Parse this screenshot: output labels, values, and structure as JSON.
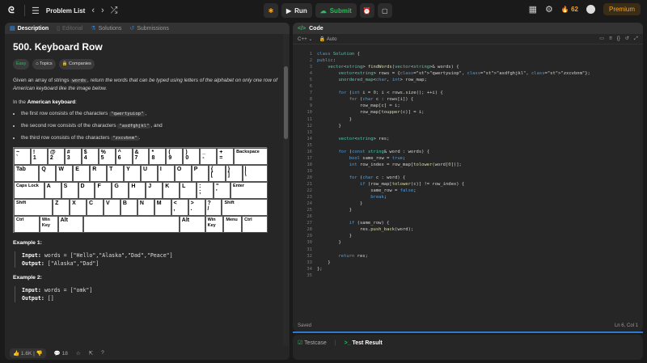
{
  "topbar": {
    "title": "Problem List",
    "run": "Run",
    "submit": "Submit",
    "streak": "62",
    "premium": "Premium"
  },
  "left_tabs": [
    "Description",
    "Editorial",
    "Solutions",
    "Submissions"
  ],
  "problem": {
    "title": "500. Keyboard Row",
    "difficulty": "Easy",
    "chips": [
      "Topics",
      "Companies"
    ],
    "desc_1": "Given an array of strings",
    "desc_code": "words",
    "desc_2": ", return the words that can be typed using letters of the alphabet on only one row of American keyboard like the image below.",
    "kbd_intro_1": "In the",
    "kbd_intro_bold": "American keyboard",
    "kbd_intro_2": ":",
    "rows": [
      {
        "pre": "the first row consists of the characters",
        "code": "\"qwertyuiop\"",
        "post": ","
      },
      {
        "pre": "the second row consists of the characters",
        "code": "\"asdfghjkl\"",
        "post": ", and"
      },
      {
        "pre": "the third row consists of the characters",
        "code": "\"zxcvbnm\"",
        "post": "."
      }
    ],
    "examples": [
      {
        "title": "Example 1:",
        "input_label": "Input:",
        "input": "words = [\"Hello\",\"Alaska\",\"Dad\",\"Peace\"]",
        "output_label": "Output:",
        "output": "[\"Alaska\",\"Dad\"]"
      },
      {
        "title": "Example 2:",
        "input_label": "Input:",
        "input": "words = [\"omk\"]",
        "output_label": "Output:",
        "output": "[]"
      }
    ]
  },
  "footer": {
    "likes": "1.6K",
    "comments": "18"
  },
  "code_panel": {
    "tab": "Code",
    "lang": "C++",
    "mode": "Auto",
    "saved": "Saved",
    "position": "Ln 6, Col 1"
  },
  "bottom_tabs": [
    "Testcase",
    "Test Result"
  ],
  "keyboard": {
    "row1": [
      "~\n`",
      "!\n1",
      "@\n2",
      "#\n3",
      "$\n4",
      "%\n5",
      "^\n6",
      "&\n7",
      "*\n8",
      "(\n9",
      ")\n0",
      "_\n-",
      "+\n=",
      "Backspace"
    ],
    "row2": [
      "Tab",
      "Q",
      "W",
      "E",
      "R",
      "T",
      "Y",
      "U",
      "I",
      "O",
      "P",
      "{\n[",
      "}\n]",
      "|\n\\"
    ],
    "row3": [
      "Caps Lock",
      "A",
      "S",
      "D",
      "F",
      "G",
      "H",
      "J",
      "K",
      "L",
      ":\n;",
      "\"\n'",
      "Enter"
    ],
    "row4": [
      "Shift",
      "Z",
      "X",
      "C",
      "V",
      "B",
      "N",
      "M",
      "<\n,",
      ">\n.",
      "?\n/",
      "Shift"
    ],
    "row5": [
      "Ctrl",
      "Win\nKey",
      "Alt",
      "",
      "Alt",
      "Win\nKey",
      "Menu",
      "Ctrl"
    ]
  },
  "code_lines": [
    "class Solution {",
    "public:",
    "    vector<string> findWords(vector<string>& words) {",
    "        vector<string> rows = {\"qwertyuiop\", \"asdfghjkl\", \"zxcvbnm\"};",
    "        unordered_map<char, int> row_map;",
    "",
    "        for (int i = 0; i < rows.size(); ++i) {",
    "            for (char c : rows[i]) {",
    "                row_map[c] = i;",
    "                row_map[toupper(c)] = i;",
    "            }",
    "        }",
    "",
    "        vector<string> res;",
    "",
    "        for (const string& word : words) {",
    "            bool same_row = true;",
    "            int row_index = row_map[tolower(word[0])];",
    "",
    "            for (char c : word) {",
    "                if (row_map[tolower(c)] != row_index) {",
    "                    same_row = false;",
    "                    break;",
    "                }",
    "            }",
    "",
    "            if (same_row) {",
    "                res.push_back(word);",
    "            }",
    "        }",
    "",
    "        return res;",
    "    }",
    "};",
    ""
  ]
}
